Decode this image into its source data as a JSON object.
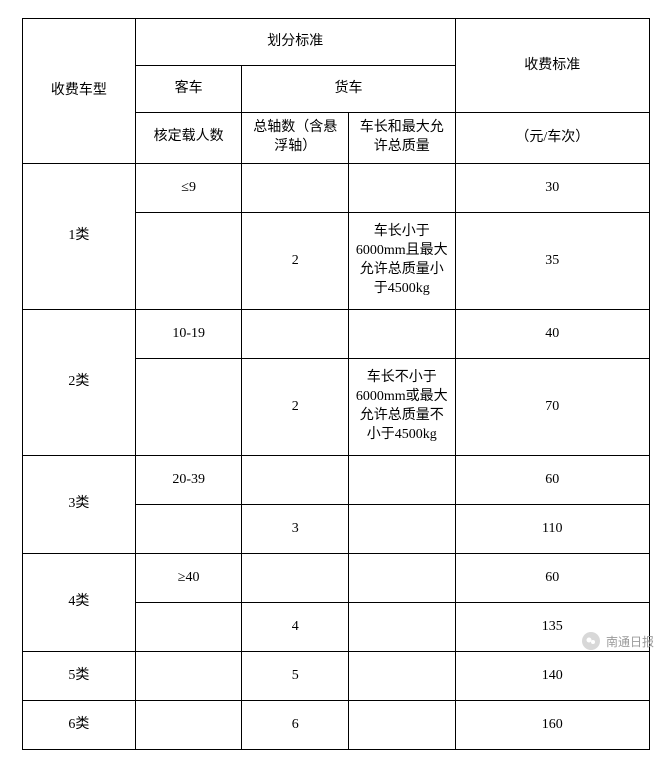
{
  "headers": {
    "vehicle_type": "收费车型",
    "criteria": "划分标准",
    "bus": "客车",
    "truck": "货车",
    "bus_sub": "核定载人数",
    "truck_axles": "总轴数（含悬浮轴）",
    "truck_dim": "车长和最大允许总质量",
    "fee": "收费标准",
    "fee_unit": "（元/车次）"
  },
  "rows": {
    "c1": {
      "label": "1类",
      "bus_capacity": "≤9",
      "bus_fee": "30",
      "truck_axles": "2",
      "truck_dim": "车长小于6000mm且最大允许总质量小于4500kg",
      "truck_fee": "35"
    },
    "c2": {
      "label": "2类",
      "bus_capacity": "10-19",
      "bus_fee": "40",
      "truck_axles": "2",
      "truck_dim": "车长不小于6000mm或最大允许总质量不小于4500kg",
      "truck_fee": "70"
    },
    "c3": {
      "label": "3类",
      "bus_capacity": "20-39",
      "bus_fee": "60",
      "truck_axles": "3",
      "truck_fee": "110"
    },
    "c4": {
      "label": "4类",
      "bus_capacity": "≥40",
      "bus_fee": "60",
      "truck_axles": "4",
      "truck_fee": "135"
    },
    "c5": {
      "label": "5类",
      "truck_axles": "5",
      "truck_fee": "140"
    },
    "c6": {
      "label": "6类",
      "truck_axles": "6",
      "truck_fee": "160"
    }
  },
  "watermark": {
    "text": "南通日报"
  }
}
